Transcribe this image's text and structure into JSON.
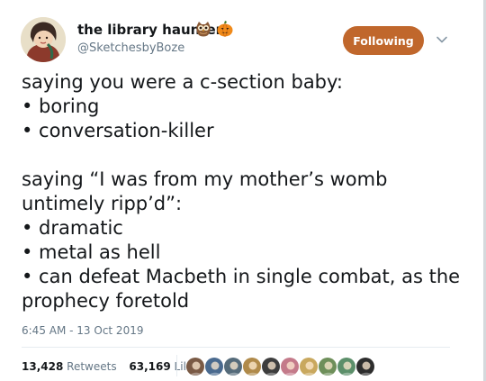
{
  "author": {
    "display_name": "the library haunter",
    "handle": "@SketchesbyBoze",
    "name_emojis": [
      "owl-emoji",
      "pumpkin-emoji"
    ]
  },
  "follow_button": {
    "label": "Following",
    "color": "#c0672c"
  },
  "tweet": {
    "lines": [
      "saying you were a c-section baby:",
      "• boring",
      "• conversation-killer",
      "",
      "saying “I was from my mother’s womb",
      "untimely ripp’d”:",
      "• dramatic",
      "• metal as hell",
      "• can defeat Macbeth in single combat, as the",
      "prophecy foretold"
    ],
    "timestamp": "6:45 AM - 13 Oct 2019"
  },
  "stats": {
    "retweets_count": "13,428",
    "retweets_label": "Retweets",
    "likes_count": "63,169",
    "likes_label": "Likes"
  },
  "likers": {
    "count_shown": 10,
    "colors": [
      "#7a5a45",
      "#4a6a8f",
      "#556b7a",
      "#b08a4a",
      "#3d3d3d",
      "#c47a8a",
      "#c9a85e",
      "#6e8f5a",
      "#5c8f6a",
      "#2d2d2d"
    ]
  }
}
